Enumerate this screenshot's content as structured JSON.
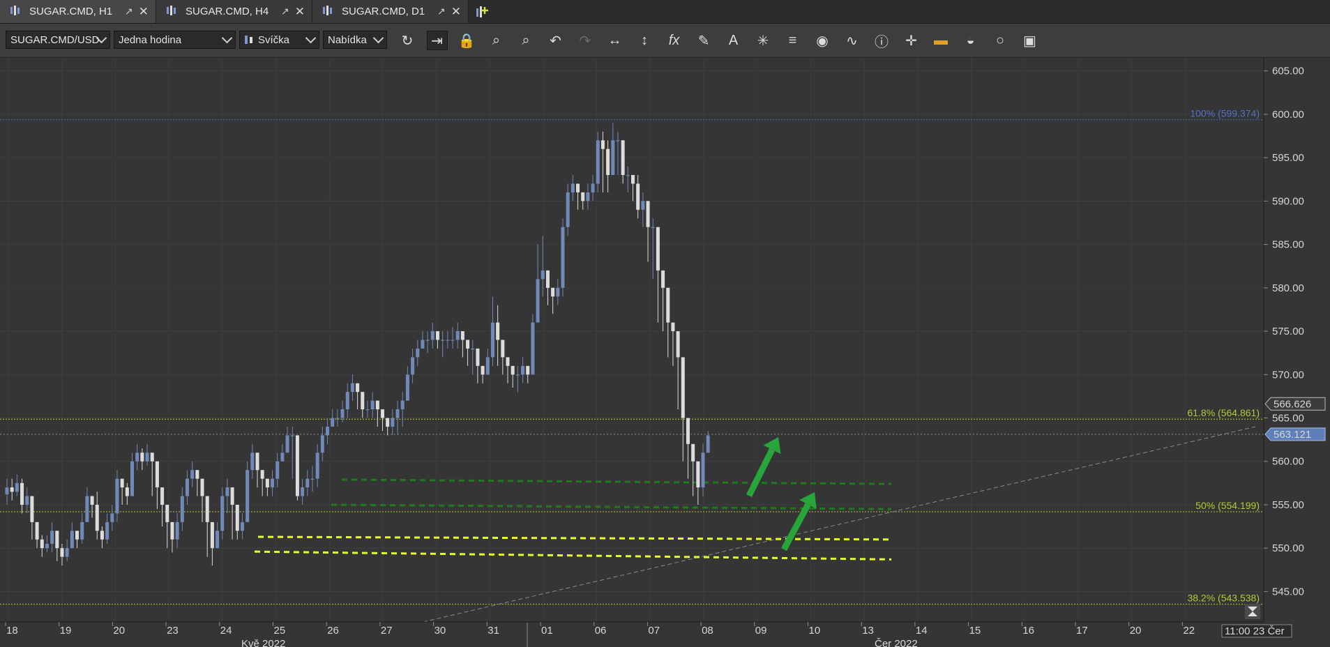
{
  "tabs": [
    {
      "label": "SUGAR.CMD, H1",
      "active": true
    },
    {
      "label": "SUGAR.CMD, H4",
      "active": false
    },
    {
      "label": "SUGAR.CMD, D1",
      "active": false
    }
  ],
  "toolbar": {
    "instrument": "SUGAR.CMD/USD",
    "period": "Jedna hodina",
    "chart_type": "Svíčka",
    "price_side": "Nabídka",
    "icons": [
      "refresh-icon",
      "shift-chart-icon",
      "lock-icon",
      "zoom-in-icon",
      "zoom-out-icon",
      "undo-icon",
      "redo-icon",
      "fit-horizontal-icon",
      "fit-vertical-icon",
      "indicators-fx-icon",
      "pencil-icon",
      "text-icon",
      "patterns-icon",
      "layers-icon",
      "eye-icon",
      "signals-icon",
      "info-icon",
      "crosshair-icon",
      "color-scheme-icon",
      "paint-bucket-icon",
      "circle-icon",
      "save-icon"
    ]
  },
  "colors": {
    "bull_candle": "#7089b9",
    "bear_candle": "#dcdcdc",
    "fib_100": "#5570c8",
    "fib_other": "#b6c832",
    "green_arrow": "#27a53a",
    "dashed_green": "#1f7a1f",
    "dashed_yellow": "#e8ff2a",
    "price_tag": "#5e7fb8"
  },
  "chart_data": {
    "type": "candlestick",
    "symbol": "SUGAR.CMD/USD",
    "timeframe": "H1",
    "ylim": [
      541.5,
      606.5
    ],
    "y_ticks": [
      "545.00",
      "550.00",
      "555.00",
      "560.00",
      "565.00",
      "570.00",
      "575.00",
      "580.00",
      "585.00",
      "590.00",
      "595.00",
      "600.00",
      "605.00"
    ],
    "x_labels": [
      "18",
      "19",
      "20",
      "23",
      "24",
      "25",
      "26",
      "27",
      "30",
      "31",
      "01",
      "06",
      "07",
      "08",
      "09",
      "10",
      "13",
      "14",
      "15",
      "16",
      "17",
      "20",
      "22"
    ],
    "x_month_labels": [
      "Kvě 2022",
      "Čer 2022"
    ],
    "time_label": "11:00 23 Čer",
    "price_labels": [
      "566.626",
      "563.121"
    ],
    "price_label_values": [
      566.626,
      563.121
    ],
    "fibonacci": [
      {
        "label": "100% (599.374)",
        "value": 599.374
      },
      {
        "label": "61.8% (564.861)",
        "value": 564.861
      },
      {
        "label": "50% (554.199)",
        "value": 554.199
      },
      {
        "label": "38.2% (543.538)",
        "value": 543.538
      }
    ],
    "horizontal_lines": [
      {
        "value": 563.121,
        "style": "dotted-gray"
      }
    ],
    "dashed_levels": [
      {
        "y": 557.9,
        "y_end": 557.4,
        "color": "green"
      },
      {
        "y": 555.0,
        "y_end": 554.5,
        "color": "green"
      },
      {
        "y": 551.3,
        "y_end": 551.0,
        "color": "yellow"
      },
      {
        "y": 549.6,
        "y_end": 548.7,
        "color": "yellow"
      }
    ],
    "trendline": {
      "from": 541.5,
      "to": 564.0
    },
    "candles_close": [
      557,
      556.5,
      557.5,
      555,
      556,
      553,
      551,
      550,
      550.5,
      552,
      550,
      549,
      550,
      552,
      551,
      553,
      556,
      555,
      552,
      551,
      553,
      554,
      558,
      557,
      556,
      560,
      561,
      560,
      561,
      560,
      557,
      555,
      553,
      551,
      553,
      556,
      558,
      559,
      558,
      556,
      553,
      550,
      552,
      556,
      557,
      555,
      552,
      553,
      559,
      561,
      559,
      558,
      557,
      558,
      560,
      561,
      563,
      563,
      556,
      557,
      558,
      558,
      561,
      563,
      564,
      565,
      565,
      566,
      568,
      569,
      568,
      566,
      566,
      567,
      566,
      565,
      564,
      565,
      566,
      567,
      570,
      572,
      573,
      574,
      574,
      575,
      574,
      574,
      574,
      574,
      575,
      574,
      573,
      573,
      571,
      570,
      572,
      576,
      574,
      572,
      571,
      570,
      570,
      571,
      570,
      576,
      581,
      582,
      580,
      579,
      580,
      587,
      591,
      592,
      591,
      590,
      591,
      592,
      597,
      596,
      593,
      597,
      597,
      593,
      593,
      592,
      589,
      590,
      587,
      587,
      582,
      580,
      576,
      575,
      572,
      565,
      562,
      560,
      557,
      561,
      563
    ],
    "candles_wicks": [
      [
        558,
        555
      ],
      [
        558,
        555.5
      ],
      [
        558.5,
        556
      ],
      [
        558,
        554
      ],
      [
        557,
        554
      ],
      [
        554,
        551
      ],
      [
        552,
        550
      ],
      [
        551.5,
        549
      ],
      [
        551.5,
        549.5
      ],
      [
        553,
        549.5
      ],
      [
        551,
        548.5
      ],
      [
        550.5,
        548
      ],
      [
        551,
        548.5
      ],
      [
        553,
        550
      ],
      [
        552,
        550
      ],
      [
        554,
        550.5
      ],
      [
        557,
        553
      ],
      [
        556,
        553.5
      ],
      [
        556.5,
        551
      ],
      [
        552.5,
        550
      ],
      [
        554,
        550.5
      ],
      [
        555,
        552
      ],
      [
        559,
        553
      ],
      [
        558,
        555
      ],
      [
        557.5,
        555
      ],
      [
        561,
        556
      ],
      [
        562,
        559
      ],
      [
        561.5,
        559
      ],
      [
        562,
        559.5
      ],
      [
        561,
        556
      ],
      [
        558,
        554.5
      ],
      [
        556,
        552.5
      ],
      [
        554,
        550
      ],
      [
        552,
        549.5
      ],
      [
        554,
        550
      ],
      [
        557,
        552
      ],
      [
        559,
        555
      ],
      [
        560,
        557
      ],
      [
        559,
        556
      ],
      [
        557,
        553
      ],
      [
        554,
        549
      ],
      [
        551,
        548
      ],
      [
        553,
        550
      ],
      [
        557,
        551
      ],
      [
        558,
        554
      ],
      [
        556,
        551
      ],
      [
        553,
        551
      ],
      [
        554,
        551
      ],
      [
        560,
        553
      ],
      [
        562,
        558
      ],
      [
        560,
        557
      ],
      [
        559,
        556
      ],
      [
        558,
        556
      ],
      [
        559,
        556
      ],
      [
        561,
        557
      ],
      [
        562,
        560
      ],
      [
        564,
        561
      ],
      [
        564,
        558
      ],
      [
        558,
        555.5
      ],
      [
        558,
        555
      ],
      [
        559,
        556
      ],
      [
        559.5,
        556.5
      ],
      [
        562,
        557
      ],
      [
        564,
        560
      ],
      [
        565,
        562
      ],
      [
        566,
        564
      ],
      [
        566,
        564
      ],
      [
        567,
        564.5
      ],
      [
        569,
        565
      ],
      [
        570,
        567
      ],
      [
        569,
        566
      ],
      [
        567,
        565
      ],
      [
        567,
        565
      ],
      [
        568,
        565
      ],
      [
        567,
        564
      ],
      [
        566,
        563.5
      ],
      [
        565,
        563
      ],
      [
        566,
        563
      ],
      [
        567,
        563
      ],
      [
        568,
        564
      ],
      [
        571,
        567
      ],
      [
        573,
        569
      ],
      [
        574,
        571
      ],
      [
        575,
        573
      ],
      [
        575,
        572.5
      ],
      [
        576,
        573
      ],
      [
        575,
        573
      ],
      [
        575,
        572
      ],
      [
        575,
        573
      ],
      [
        575.5,
        573
      ],
      [
        576,
        573
      ],
      [
        575,
        572
      ],
      [
        574,
        571
      ],
      [
        574,
        570
      ],
      [
        572,
        569
      ],
      [
        571,
        569
      ],
      [
        573,
        570
      ],
      [
        579,
        571
      ],
      [
        578,
        571
      ],
      [
        574,
        570
      ],
      [
        572,
        569
      ],
      [
        571,
        568.5
      ],
      [
        571,
        568
      ],
      [
        572,
        569
      ],
      [
        571,
        569
      ],
      [
        577,
        570
      ],
      [
        585,
        577
      ],
      [
        586,
        579
      ],
      [
        582,
        578
      ],
      [
        580,
        577
      ],
      [
        581,
        578
      ],
      [
        588,
        579
      ],
      [
        592,
        586
      ],
      [
        593,
        590
      ],
      [
        592,
        589
      ],
      [
        591,
        589
      ],
      [
        592,
        589
      ],
      [
        593,
        590
      ],
      [
        598,
        591
      ],
      [
        598,
        591
      ],
      [
        597,
        591
      ],
      [
        599,
        595
      ],
      [
        598,
        593
      ],
      [
        597,
        592
      ],
      [
        594,
        591
      ],
      [
        593,
        590
      ],
      [
        593,
        588
      ],
      [
        591,
        587
      ],
      [
        588,
        583
      ],
      [
        588,
        581
      ],
      [
        583,
        576
      ],
      [
        581,
        575
      ],
      [
        578,
        572
      ],
      [
        576,
        571
      ],
      [
        574,
        566
      ],
      [
        567,
        560
      ],
      [
        563,
        558
      ],
      [
        562,
        556
      ],
      [
        560,
        555
      ],
      [
        562,
        556
      ],
      [
        563.5,
        561
      ]
    ]
  }
}
